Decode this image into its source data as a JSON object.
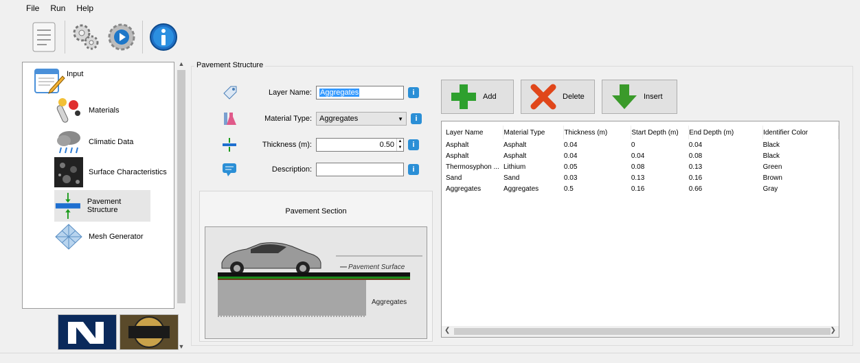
{
  "menu": [
    "File",
    "Run",
    "Help"
  ],
  "toolbar": {
    "icons": [
      "document-icon",
      "gears-icon",
      "run-icon",
      "info-icon"
    ]
  },
  "tree": {
    "items": [
      {
        "label": "Input",
        "icon": "input-icon"
      },
      {
        "label": "Materials",
        "icon": "materials-icon"
      },
      {
        "label": "Climatic Data",
        "icon": "climate-icon"
      },
      {
        "label": "Surface Characteristics",
        "icon": "surface-icon"
      },
      {
        "label": "Pavement Structure",
        "icon": "pavement-icon",
        "selected": true
      },
      {
        "label": "Mesh Generator",
        "icon": "mesh-icon"
      }
    ]
  },
  "group_title": "Pavement Structure",
  "form": {
    "layer_name_label": "Layer Name:",
    "layer_name_value": "Aggregates",
    "material_type_label": "Material Type:",
    "material_type_value": "Aggregates",
    "thickness_label": "Thickness (m):",
    "thickness_value": "0.50",
    "description_label": "Description:",
    "description_value": ""
  },
  "section": {
    "title": "Pavement Section",
    "surface_label": "Pavement Surface",
    "layer_label": "Aggregates"
  },
  "buttons": {
    "add": "Add",
    "delete": "Delete",
    "insert": "Insert"
  },
  "grid": {
    "columns": [
      "Layer Name",
      "Material Type",
      "Thickness (m)",
      "Start Depth (m)",
      "End Depth (m)",
      "Identifier Color"
    ],
    "rows": [
      [
        "Asphalt",
        "Asphalt",
        "0.04",
        "0",
        "0.04",
        "Black"
      ],
      [
        "Asphalt",
        "Asphalt",
        "0.04",
        "0.04",
        "0.08",
        "Black"
      ],
      [
        "Thermosyphon ...",
        "Lithium",
        "0.05",
        "0.08",
        "0.13",
        "Green"
      ],
      [
        "Sand",
        "Sand",
        "0.03",
        "0.13",
        "0.16",
        "Brown"
      ],
      [
        "Aggregates",
        "Aggregates",
        "0.5",
        "0.16",
        "0.66",
        "Gray"
      ]
    ]
  },
  "colors": {
    "accent": "#2b8fd6",
    "selection": "#3399ff"
  }
}
